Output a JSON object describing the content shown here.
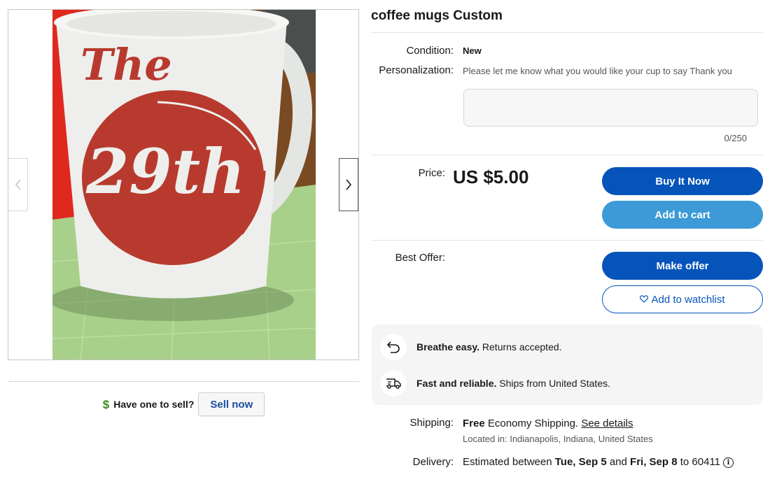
{
  "listing": {
    "title": "coffee mugs Custom",
    "photo_text_top": "The",
    "photo_text_center": "29th"
  },
  "gallery": {
    "prev_icon": "chevron-left-icon",
    "next_icon": "chevron-right-icon"
  },
  "sell": {
    "icon": "dollar-icon",
    "icon_glyph": "$",
    "question": "Have one to sell?",
    "button": "Sell now"
  },
  "details": {
    "condition_label": "Condition:",
    "condition_value": "New",
    "personalization_label": "Personalization:",
    "personalization_hint": "Please let me know what you would like your cup to say Thank you",
    "personalization_value": "",
    "counter": "0/250"
  },
  "pricing": {
    "price_label": "Price:",
    "price_value": "US $5.00",
    "buy_now": "Buy It Now",
    "add_to_cart": "Add to cart",
    "best_offer_label": "Best Offer:",
    "make_offer": "Make offer",
    "watchlist": "Add to watchlist",
    "watchlist_icon": "heart-icon"
  },
  "promos": [
    {
      "icon": "return-arrow-icon",
      "bold": "Breathe easy.",
      "text": " Returns accepted."
    },
    {
      "icon": "delivery-truck-icon",
      "bold": "Fast and reliable.",
      "text": " Ships from United States."
    }
  ],
  "shipping": {
    "label": "Shipping:",
    "free": "Free",
    "text": " Economy Shipping. ",
    "details_link": "See details",
    "location": "Located in: Indianapolis, Indiana, United States"
  },
  "delivery": {
    "label": "Delivery:",
    "prefix": "Estimated between ",
    "start": "Tue, Sep 5",
    "and": " and ",
    "end": "Fri, Sep 8",
    "to": " to 60411",
    "info_icon": "info-icon",
    "info_glyph": "i"
  },
  "colors": {
    "primary_blue": "#0654ba",
    "secondary_blue": "#3d9ad6",
    "link_blue": "#1a4ea0",
    "mug_red": "#b83a2e"
  }
}
